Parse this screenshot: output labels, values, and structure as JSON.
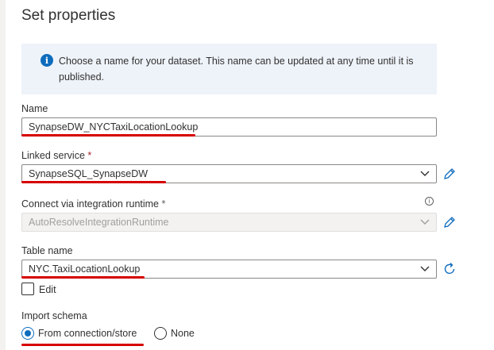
{
  "panel": {
    "title": "Set properties",
    "info_message": "Choose a name for your dataset. This name can be updated at any time until it is published."
  },
  "name_field": {
    "label": "Name",
    "value": "SynapseDW_NYCTaxiLocationLookup"
  },
  "linked_service": {
    "label": "Linked service",
    "required_mark": "*",
    "value": "SynapseSQL_SynapseDW",
    "edit_icon": "pencil-icon"
  },
  "integration_runtime": {
    "label": "Connect via integration runtime",
    "required_mark": "*",
    "value": "AutoResolveIntegrationRuntime",
    "info_glyph": "i",
    "edit_icon": "pencil-icon"
  },
  "table_name": {
    "label": "Table name",
    "value": "NYC.TaxiLocationLookup",
    "refresh_icon": "refresh-icon",
    "edit_checkbox_label": "Edit",
    "edit_checked": false
  },
  "import_schema": {
    "label": "Import schema",
    "options": [
      "From connection/store",
      "None"
    ],
    "selected": "From connection/store"
  },
  "colors": {
    "accent": "#0f6cbd",
    "annotation": "#d60000",
    "info_background": "#eef3fa"
  }
}
